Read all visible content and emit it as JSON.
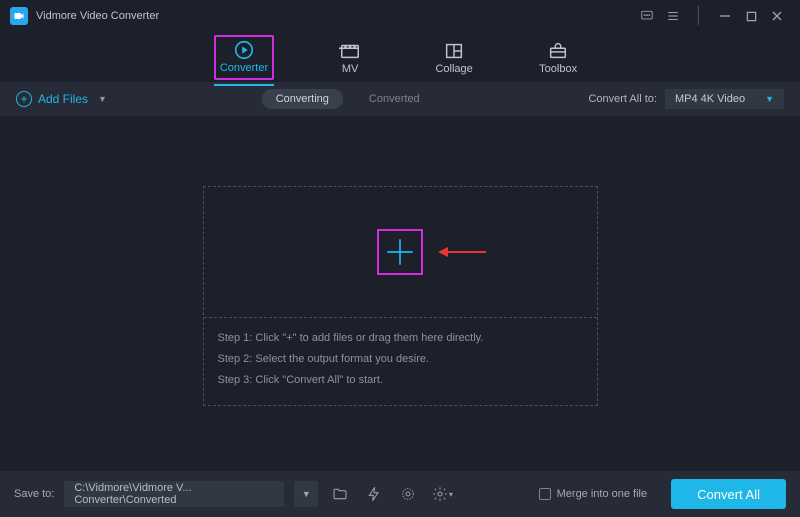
{
  "app": {
    "title": "Vidmore Video Converter"
  },
  "tabs": {
    "converter": "Converter",
    "mv": "MV",
    "collage": "Collage",
    "toolbox": "Toolbox",
    "active": "converter"
  },
  "toolbar": {
    "add_files": "Add Files",
    "converting": "Converting",
    "converted": "Converted",
    "convert_all_to": "Convert All to:",
    "format_selected": "MP4 4K Video"
  },
  "dropzone": {
    "step1": "Step 1: Click \"+\" to add files or drag them here directly.",
    "step2": "Step 2: Select the output format you desire.",
    "step3": "Step 3: Click \"Convert All\" to start."
  },
  "footer": {
    "save_to": "Save to:",
    "path": "C:\\Vidmore\\Vidmore V... Converter\\Converted",
    "merge": "Merge into one file",
    "convert_all": "Convert All"
  }
}
